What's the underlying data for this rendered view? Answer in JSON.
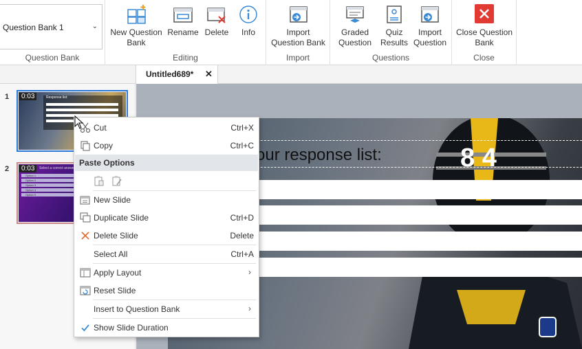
{
  "ribbon": {
    "question_bank": {
      "selected": "Question Bank 1",
      "label": "Question Bank"
    },
    "editing": {
      "label": "Editing",
      "new_question_bank": "New Question Bank",
      "rename": "Rename",
      "delete": "Delete",
      "info": "Info"
    },
    "import": {
      "label": "Import",
      "import_question_bank": "Import Question Bank"
    },
    "questions": {
      "label": "Questions",
      "graded_question": "Graded Question",
      "quiz_results": "Quiz Results",
      "import_question": "Import Question"
    },
    "close": {
      "label": "Close",
      "close_question_bank": "Close Question Bank"
    },
    "colors": {
      "accent": "#2b78d8",
      "close_red": "#e03a32"
    }
  },
  "tabs": {
    "doc_title": "Untitled689*",
    "close": "✕"
  },
  "slides": [
    {
      "number": "1",
      "duration": "0:03",
      "caption": "Response list:"
    },
    {
      "number": "2",
      "duration": "0:03",
      "caption": "Select a correct answer option:",
      "options": [
        "Option 1",
        "Option 2",
        "Option 3",
        "Option 4",
        "Option 5"
      ]
    }
  ],
  "slide": {
    "title": "our response list:"
  },
  "context_menu": {
    "cut": {
      "label": "Cut",
      "shortcut": "Ctrl+X"
    },
    "copy": {
      "label": "Copy",
      "shortcut": "Ctrl+C"
    },
    "paste_options": "Paste Options",
    "new_slide": "New Slide",
    "duplicate_slide": {
      "label": "Duplicate Slide",
      "shortcut": "Ctrl+D"
    },
    "delete_slide": {
      "label": "Delete Slide",
      "shortcut": "Delete"
    },
    "select_all": {
      "label": "Select All",
      "shortcut": "Ctrl+A"
    },
    "apply_layout": "Apply Layout",
    "reset_slide": "Reset Slide",
    "insert_to_question_bank": "Insert to Question Bank",
    "show_slide_duration": "Show Slide Duration",
    "submenu_arrow": "›"
  }
}
